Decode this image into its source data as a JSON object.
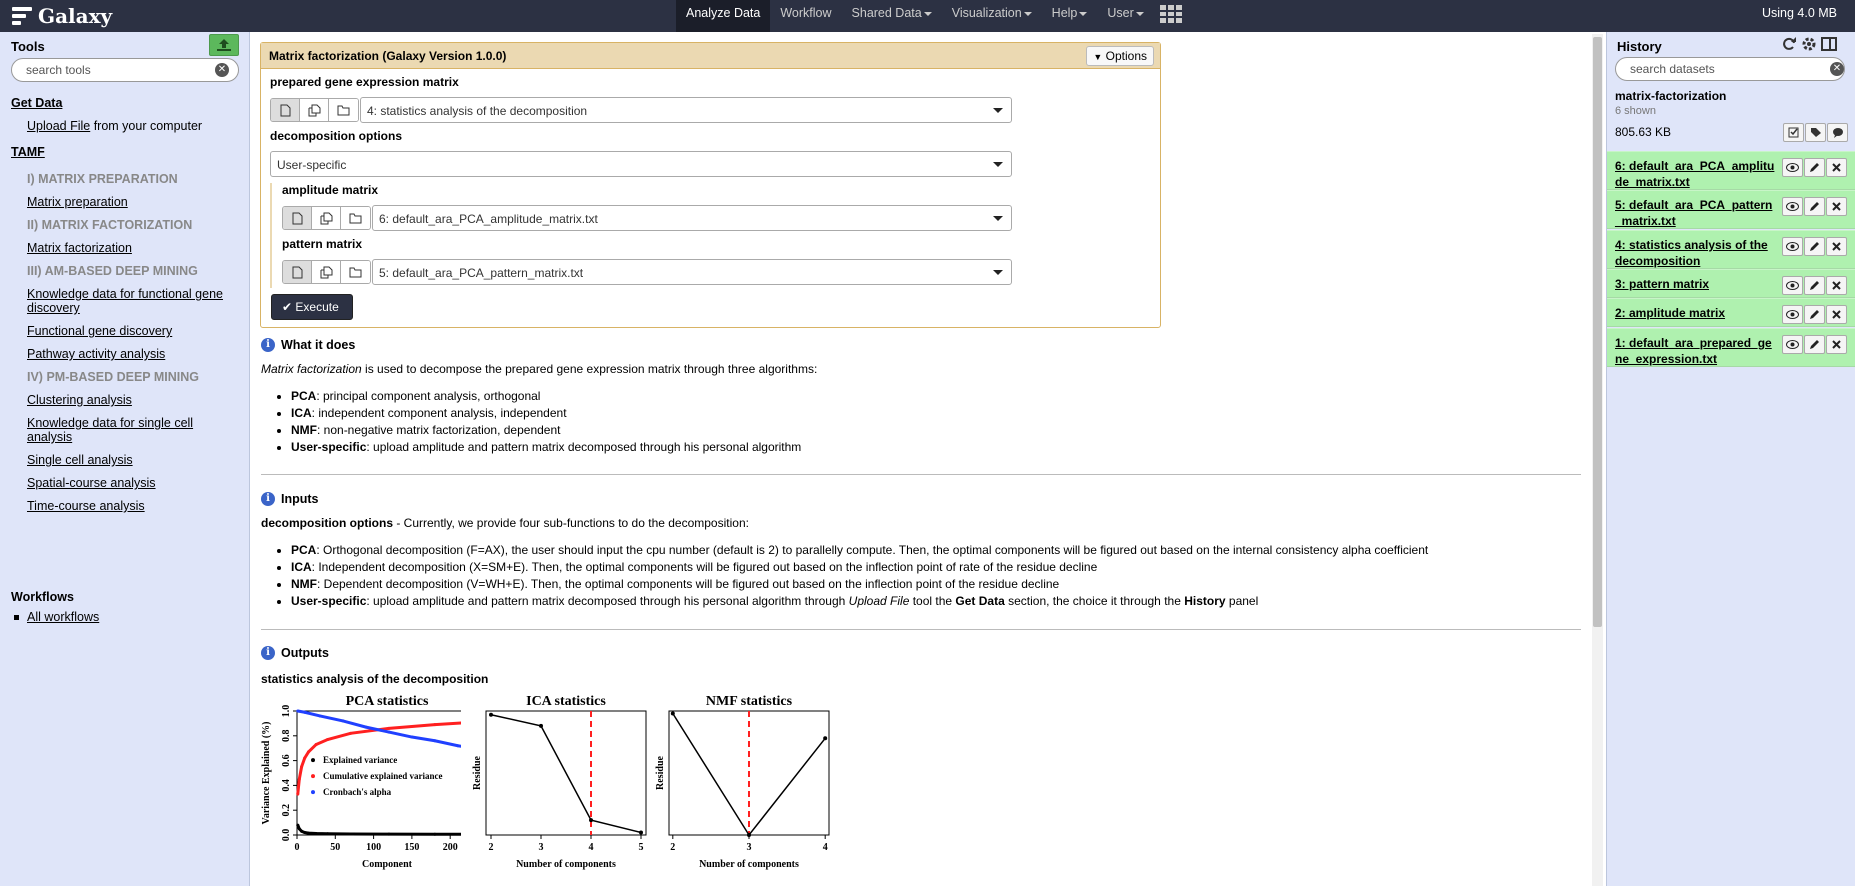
{
  "masthead": {
    "brand": "Galaxy",
    "nav": [
      "Analyze Data",
      "Workflow",
      "Shared Data",
      "Visualization",
      "Help",
      "User"
    ],
    "nav_has_caret": [
      false,
      false,
      true,
      true,
      true,
      true
    ],
    "usage": "Using 4.0 MB"
  },
  "tools": {
    "title": "Tools",
    "search_placeholder": "search tools",
    "get_data": "Get Data",
    "upload_link": "Upload File",
    "upload_suffix": " from your computer",
    "tamf": "TAMF",
    "items": [
      {
        "type": "sec",
        "label": "I) MATRIX PREPARATION"
      },
      {
        "type": "link",
        "label": "Matrix preparation"
      },
      {
        "type": "sec",
        "label": "II) MATRIX FACTORIZATION"
      },
      {
        "type": "link",
        "label": "Matrix factorization"
      },
      {
        "type": "sec",
        "label": "III) AM-BASED DEEP MINING"
      },
      {
        "type": "link",
        "label": "Knowledge data for functional gene"
      },
      {
        "type": "link",
        "label": "discovery"
      },
      {
        "type": "link",
        "label": "Functional gene discovery"
      },
      {
        "type": "link",
        "label": "Pathway activity analysis"
      },
      {
        "type": "sec",
        "label": "IV) PM-BASED DEEP MINING"
      },
      {
        "type": "link",
        "label": "Clustering analysis"
      },
      {
        "type": "link",
        "label": "Knowledge data for single cell"
      },
      {
        "type": "link",
        "label": "analysis"
      },
      {
        "type": "link",
        "label": "Single cell analysis"
      },
      {
        "type": "link",
        "label": "Spatial-course analysis"
      },
      {
        "type": "link",
        "label": "Time-course analysis"
      }
    ],
    "workflows_title": "Workflows",
    "all_workflows": "All workflows"
  },
  "form": {
    "title": "Matrix factorization (Galaxy Version 1.0.0)",
    "options": "Options",
    "prepared_label": "prepared gene expression matrix",
    "prepared_value": "4: statistics analysis of the decomposition",
    "decomp_label": "decomposition options",
    "decomp_value": "User-specific",
    "amplitude_label": "amplitude matrix",
    "amplitude_value": "6: default_ara_PCA_amplitude_matrix.txt",
    "pattern_label": "pattern matrix",
    "pattern_value": "5: default_ara_PCA_pattern_matrix.txt",
    "execute": "Execute"
  },
  "help": {
    "what_title": "What it does",
    "what_intro_em": "Matrix factorization",
    "what_intro_rest": " is used to decompose the prepared gene expression matrix through three algorithms:",
    "what_items": [
      {
        "b": "PCA",
        "t": ": principal component analysis, orthogonal"
      },
      {
        "b": "ICA",
        "t": ": independent component analysis, independent"
      },
      {
        "b": "NMF",
        "t": ": non-negative matrix factorization, dependent"
      },
      {
        "b": "User-specific",
        "t": ": upload amplitude and pattern matrix decomposed through his personal algorithm"
      }
    ],
    "inputs_title": "Inputs",
    "inputs_intro_b": "decomposition options",
    "inputs_intro_rest": " - Currently, we provide four sub-functions to do the decomposition:",
    "inputs_items": [
      {
        "b": "PCA",
        "t": ": Orthogonal decomposition (F=AX), the user should input the cpu number (default is 2) to parallelly compute. Then, the optimal components will be figured out based on the internal consistency alpha coefficient"
      },
      {
        "b": "ICA",
        "t": ": Independent decomposition (X=SM+E). Then, the optimal components will be figured out based on the inflection point of rate of the residue decline"
      },
      {
        "b": "NMF",
        "t": ": Dependent decomposition (V=WH+E). Then, the optimal components will be figured out based on the inflection point of the residue decline"
      }
    ],
    "inputs_last": {
      "b": "User-specific",
      "t1": ": upload amplitude and pattern matrix decomposed through his personal algorithm through ",
      "em": "Upload File",
      "t2": " tool the ",
      "b2": "Get Data",
      "t3": " section, the choice it through the ",
      "b3": "History",
      "t4": " panel"
    },
    "outputs_title": "Outputs",
    "outputs_sub": "statistics analysis of the decomposition"
  },
  "history": {
    "title": "History",
    "search_placeholder": "search datasets",
    "name": "matrix-factorization",
    "shown": "6 shown",
    "size": "805.63 KB",
    "items": [
      "6: default_ara_PCA_amplitude_matrix.txt",
      "5: default_ara_PCA_pattern_matrix.txt",
      "4: statistics analysis of the decomposition",
      "3: pattern matrix",
      "2: amplitude matrix",
      "1: default_ara_prepared_gene_expression.txt"
    ]
  },
  "chart_data": [
    {
      "type": "line",
      "title": "PCA statistics",
      "xlabel": "Component",
      "ylabel": "Variance Explained (%)",
      "xlim": [
        0,
        235
      ],
      "ylim": [
        0,
        1
      ],
      "xticks": [
        0,
        50,
        100,
        150,
        200
      ],
      "yticks": [
        0.0,
        0.2,
        0.4,
        0.6,
        0.8,
        1.0
      ],
      "legend": [
        "Explained variance",
        "Cumulative explained variance",
        "Cronbach's alpha"
      ],
      "series": [
        {
          "name": "Explained variance",
          "color": "#000000",
          "x": [
            1,
            3,
            6,
            10,
            15,
            25,
            40,
            70,
            120,
            180,
            230
          ],
          "y": [
            0.08,
            0.05,
            0.03,
            0.02,
            0.015,
            0.012,
            0.01,
            0.008,
            0.007,
            0.006,
            0.006
          ]
        },
        {
          "name": "Cumulative explained variance",
          "color": "#ff2020",
          "x": [
            1,
            3,
            6,
            10,
            15,
            25,
            40,
            70,
            120,
            180,
            230
          ],
          "y": [
            0.33,
            0.45,
            0.55,
            0.62,
            0.67,
            0.73,
            0.77,
            0.82,
            0.86,
            0.89,
            0.91
          ]
        },
        {
          "name": "Cronbach's alpha",
          "color": "#2040ff",
          "x": [
            1,
            10,
            30,
            60,
            90,
            120,
            150,
            180,
            210,
            230
          ],
          "y": [
            1.0,
            0.99,
            0.96,
            0.92,
            0.87,
            0.83,
            0.79,
            0.76,
            0.72,
            0.7
          ]
        }
      ]
    },
    {
      "type": "line",
      "title": "ICA statistics",
      "xlabel": "Number of components",
      "ylabel": "Residue",
      "xlim": [
        1.9,
        5.1
      ],
      "ylim": [
        0,
        1
      ],
      "xticks": [
        2,
        3,
        4,
        5
      ],
      "marker_x": 4,
      "series": [
        {
          "name": "",
          "color": "#000000",
          "x": [
            2,
            3,
            4,
            5
          ],
          "y": [
            0.97,
            0.88,
            0.12,
            0.02
          ]
        }
      ]
    },
    {
      "type": "line",
      "title": "NMF statistics",
      "xlabel": "Number of components",
      "ylabel": "Residue",
      "xlim": [
        1.95,
        4.05
      ],
      "ylim": [
        0,
        1
      ],
      "xticks": [
        2,
        3,
        4
      ],
      "marker_x": 3,
      "series": [
        {
          "name": "",
          "color": "#000000",
          "x": [
            2,
            3,
            4
          ],
          "y": [
            0.98,
            0.0,
            0.78
          ]
        }
      ]
    }
  ]
}
